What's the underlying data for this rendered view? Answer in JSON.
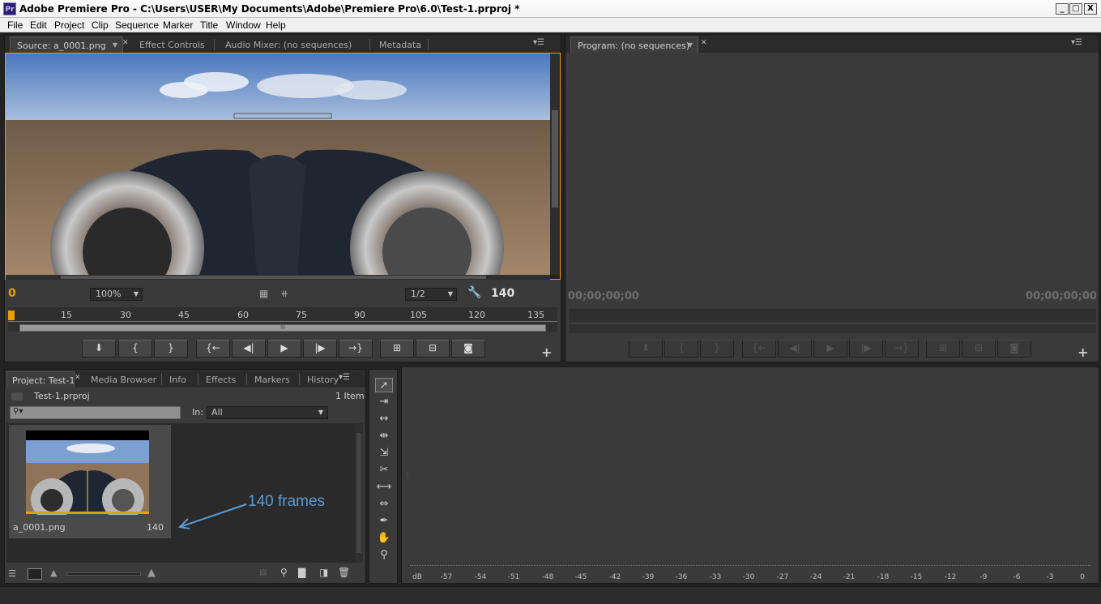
{
  "window": {
    "title": "Adobe Premiere Pro - C:\\Users\\USER\\My Documents\\Adobe\\Premiere Pro\\6.0\\Test-1.prproj *",
    "logo": "Pr",
    "buttons": {
      "minimize": "_",
      "maximize": "□",
      "close": "X"
    }
  },
  "menu": [
    "File",
    "Edit",
    "Project",
    "Clip",
    "Sequence",
    "Marker",
    "Title",
    "Window",
    "Help"
  ],
  "source_panel": {
    "tabs": [
      "Source: a_0001.png",
      "Effect Controls",
      "Audio Mixer: (no sequences)",
      "Metadata"
    ],
    "current_frame": "0",
    "zoom": "100%",
    "resolution": "1/2",
    "duration": "140",
    "ruler_ticks": [
      "15",
      "30",
      "45",
      "60",
      "75",
      "90",
      "105",
      "120",
      "135"
    ],
    "scrub_handle": "lll",
    "add_button": "+"
  },
  "program_panel": {
    "tab": "Program: (no sequences)",
    "timecode_left": "00;00;00;00",
    "timecode_right": "00;00;00;00",
    "add_button": "+"
  },
  "project_panel": {
    "tabs": [
      "Project: Test-1",
      "Media Browser",
      "Info",
      "Effects",
      "Markers",
      "History"
    ],
    "project_file": "Test-1.prproj",
    "item_count": "1 Item",
    "search_placeholder": "",
    "in_label": "In:",
    "in_value": "All",
    "clip": {
      "name": "a_0001.png",
      "frames": "140"
    },
    "annotation": "140 frames"
  },
  "tools": [
    "selection-icon",
    "track-select-icon",
    "ripple-edit-icon",
    "rolling-edit-icon",
    "rate-stretch-icon",
    "razor-icon",
    "slip-icon",
    "slide-icon",
    "pen-icon",
    "hand-icon",
    "zoom-icon"
  ],
  "audio_meter": {
    "labels": [
      "dB",
      "-57",
      "-54",
      "-51",
      "-48",
      "-45",
      "-42",
      "-39",
      "-36",
      "-33",
      "-30",
      "-27",
      "-24",
      "-21",
      "-18",
      "-15",
      "-12",
      "-9",
      "-6",
      "-3",
      "0"
    ]
  },
  "colors": {
    "accent_orange": "#e8a000",
    "annotation_blue": "#5b9bd5",
    "panel_bg": "#3a3a3a"
  }
}
